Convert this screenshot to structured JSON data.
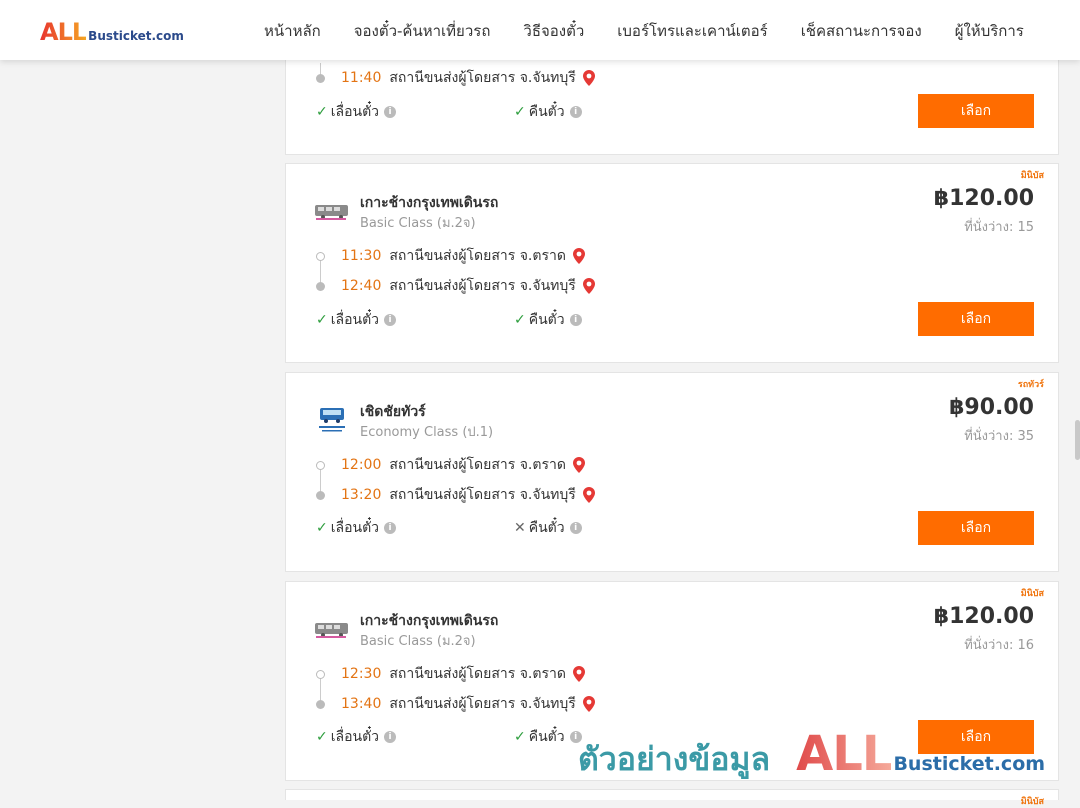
{
  "header": {
    "logo_all": "ALL",
    "logo_text": "Busticket.com",
    "nav": [
      "หน้าหลัก",
      "จองตั๋ว-ค้นหาเที่ยวรถ",
      "วิธีจองตั๋ว",
      "เบอร์โทรและเคาน์เตอร์",
      "เช็คสถานะการจอง",
      "ผู้ให้บริการ"
    ]
  },
  "cards": [
    {
      "stops": [
        {
          "time": "11:40",
          "station": "สถานีขนส่งผู้โดยสาร จ.จันทบุรี"
        }
      ],
      "options": [
        {
          "label": "เลื่อนตั๋ว",
          "available": true
        },
        {
          "label": "คืนตั๋ว",
          "available": true
        }
      ],
      "button": "เลือก"
    },
    {
      "tag": "มินิบัส",
      "operator": "เกาะช้างกรุงเทพเดินรถ",
      "class": "Basic Class (ม.2จ)",
      "price": "฿120.00",
      "seats": "ที่นั่งว่าง: 15",
      "stops": [
        {
          "time": "11:30",
          "station": "สถานีขนส่งผู้โดยสาร จ.ตราด"
        },
        {
          "time": "12:40",
          "station": "สถานีขนส่งผู้โดยสาร จ.จันทบุรี"
        }
      ],
      "options": [
        {
          "label": "เลื่อนตั๋ว",
          "available": true
        },
        {
          "label": "คืนตั๋ว",
          "available": true
        }
      ],
      "button": "เลือก"
    },
    {
      "tag": "รถทัวร์",
      "operator": "เชิดชัยทัวร์",
      "class": "Economy Class (ป.1)",
      "price": "฿90.00",
      "seats": "ที่นั่งว่าง: 35",
      "stops": [
        {
          "time": "12:00",
          "station": "สถานีขนส่งผู้โดยสาร จ.ตราด"
        },
        {
          "time": "13:20",
          "station": "สถานีขนส่งผู้โดยสาร จ.จันทบุรี"
        }
      ],
      "options": [
        {
          "label": "เลื่อนตั๋ว",
          "available": true
        },
        {
          "label": "คืนตั๋ว",
          "available": false
        }
      ],
      "button": "เลือก"
    },
    {
      "tag": "มินิบัส",
      "operator": "เกาะช้างกรุงเทพเดินรถ",
      "class": "Basic Class (ม.2จ)",
      "price": "฿120.00",
      "seats": "ที่นั่งว่าง: 16",
      "stops": [
        {
          "time": "12:30",
          "station": "สถานีขนส่งผู้โดยสาร จ.ตราด"
        },
        {
          "time": "13:40",
          "station": "สถานีขนส่งผู้โดยสาร จ.จันทบุรี"
        }
      ],
      "options": [
        {
          "label": "เลื่อนตั๋ว",
          "available": true
        },
        {
          "label": "คืนตั๋ว",
          "available": true
        }
      ],
      "button": "เลือก"
    },
    {
      "tag": "มินิบัส"
    }
  ],
  "watermark": {
    "thai": "ตัวอย่างข้อมูล",
    "all": "ALL",
    "text": "Busticket.com"
  },
  "colors": {
    "accent": "#ff6c00",
    "time": "#e37414",
    "check": "#2e9e3e",
    "pin": "#e53935"
  }
}
